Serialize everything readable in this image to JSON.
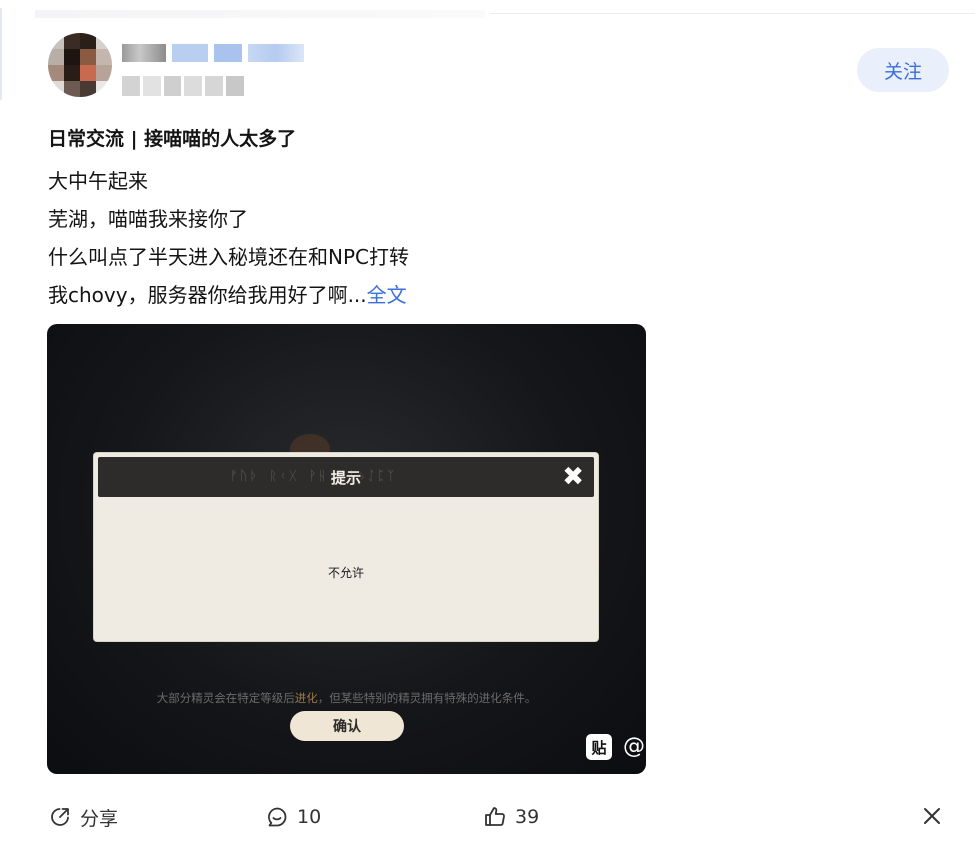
{
  "author": {
    "follow_label": "关注"
  },
  "post": {
    "title": "日常交流 | 接喵喵的人太多了",
    "lines": [
      "大中午起来",
      "芜湖，喵喵我来接你了",
      "什么叫点了半天进入秘境还在和NPC打转",
      "我chovy，服务器你给我用好了啊..."
    ],
    "more_label": "全文"
  },
  "screenshot": {
    "dialog_title": "提示",
    "dialog_close": "✖",
    "dialog_message": "不允许",
    "hint_before": "大部分精灵会在特定等级后",
    "hint_highlight": "进化",
    "hint_after": "，但某些特别的精灵拥有特殊的进化条件。",
    "confirm_label": "确认",
    "watermark_icon": "贴",
    "watermark_at": "@"
  },
  "actions": {
    "share_label": "分享",
    "comment_count": "10",
    "like_count": "39"
  },
  "colors": {
    "accent": "#3b6fd9",
    "follow_bg": "#e9effb"
  },
  "icons": {
    "share": "share-icon",
    "comment": "comment-icon",
    "like": "thumbs-up-icon",
    "close": "close-icon"
  }
}
